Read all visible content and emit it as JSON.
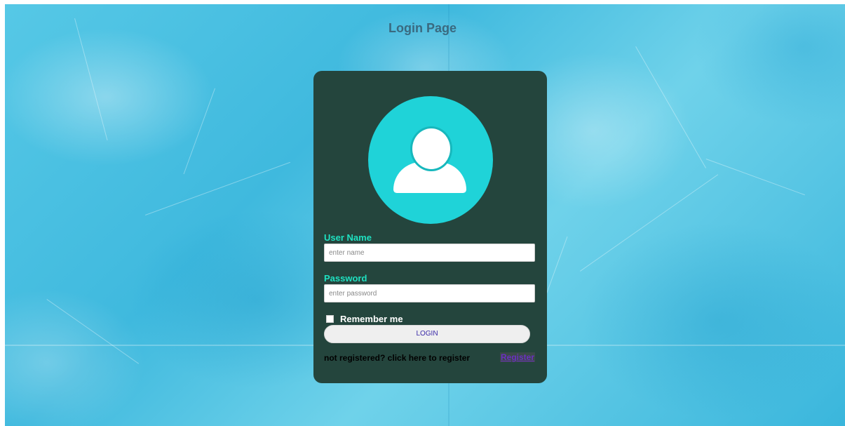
{
  "page": {
    "title": "Login Page"
  },
  "form": {
    "username": {
      "label": "User Name",
      "placeholder": "enter name",
      "value": ""
    },
    "password": {
      "label": "Password",
      "placeholder": "enter password",
      "value": ""
    },
    "remember": {
      "label": "Remember me",
      "checked": false
    },
    "login_button": "LOGIN",
    "register_prompt": "not registered? click here to register",
    "register_link": "Register"
  },
  "colors": {
    "card_background": "#24453d",
    "avatar_circle": "#1fd3d8",
    "label_accent": "#1fe0c0",
    "link": "#6b2fc2"
  },
  "icons": {
    "avatar": "user-avatar-icon"
  }
}
